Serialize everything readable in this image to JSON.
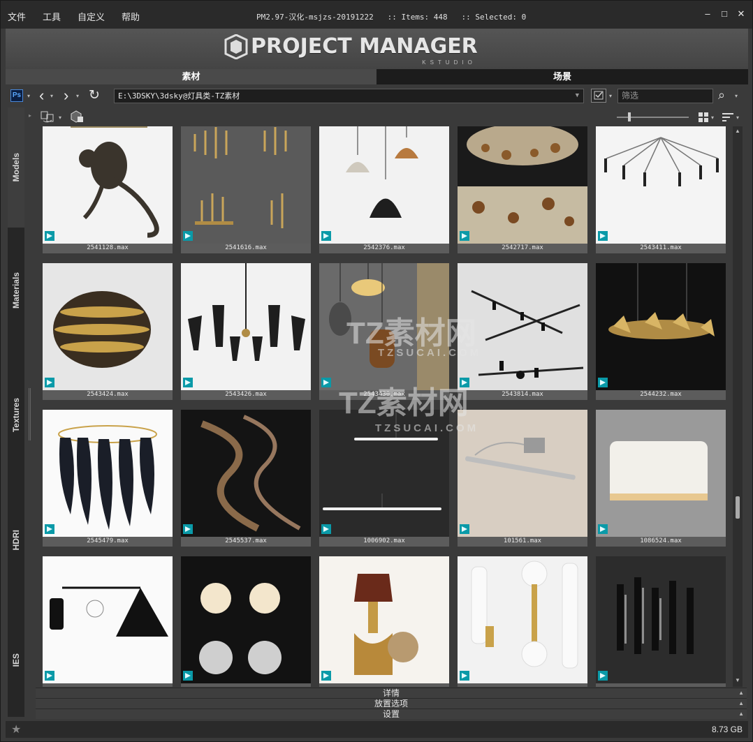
{
  "menu": [
    "文件",
    "工具",
    "自定义",
    "帮助"
  ],
  "title_info": {
    "version": "PM2.97-汉化-msjzs-20191222",
    "items": ":: Items: 448",
    "selected": ":: Selected: 0"
  },
  "window_buttons": {
    "minimize": "–",
    "maximize": "□",
    "close": "✕"
  },
  "logo": {
    "text": "PROJECT MANAGER",
    "sub": "KSTUDIO"
  },
  "tabs": {
    "assets": "素材",
    "scenes": "场景"
  },
  "toolbar": {
    "ps_label": "Ps",
    "path": "E:\\3DSKY\\3dsky@灯具类-TZ素材",
    "filter_placeholder": "筛选"
  },
  "sidebar": [
    "Models",
    "Materials",
    "Textures",
    "HDRI",
    "IES"
  ],
  "items": [
    {
      "name": "2541128.max",
      "kind": "monkey"
    },
    {
      "name": "2541616.max",
      "kind": "chandelier-gold"
    },
    {
      "name": "2542376.max",
      "kind": "pendants"
    },
    {
      "name": "2542717.max",
      "kind": "crystal"
    },
    {
      "name": "2543411.max",
      "kind": "spider"
    },
    {
      "name": "2543424.max",
      "kind": "gold-ring"
    },
    {
      "name": "2543426.max",
      "kind": "sputnik"
    },
    {
      "name": "2543430.max",
      "kind": "glass-pendants"
    },
    {
      "name": "2543814.max",
      "kind": "track"
    },
    {
      "name": "2544232.max",
      "kind": "leaf-ring"
    },
    {
      "name": "2545479.max",
      "kind": "feather"
    },
    {
      "name": "2545537.max",
      "kind": "spiral"
    },
    {
      "name": "1006902.max",
      "kind": "linear"
    },
    {
      "name": "101561.max",
      "kind": "picture-light"
    },
    {
      "name": "1086524.max",
      "kind": "wall-box"
    },
    {
      "name": "",
      "kind": "wall-cone"
    },
    {
      "name": "",
      "kind": "globes"
    },
    {
      "name": "",
      "kind": "sconce-shade"
    },
    {
      "name": "",
      "kind": "tubes"
    },
    {
      "name": "",
      "kind": "blades"
    }
  ],
  "panels": [
    "详情",
    "放置选项",
    "设置"
  ],
  "status": {
    "disk": "8.73 GB"
  },
  "watermarks": [
    "TZ素材网",
    "TZSUCAI.COM",
    "TZ素材网",
    "TZSUCAI.COM"
  ],
  "colors": {
    "accent_teal": "#0a9aa8",
    "tab_active": "#4a4a4a"
  }
}
